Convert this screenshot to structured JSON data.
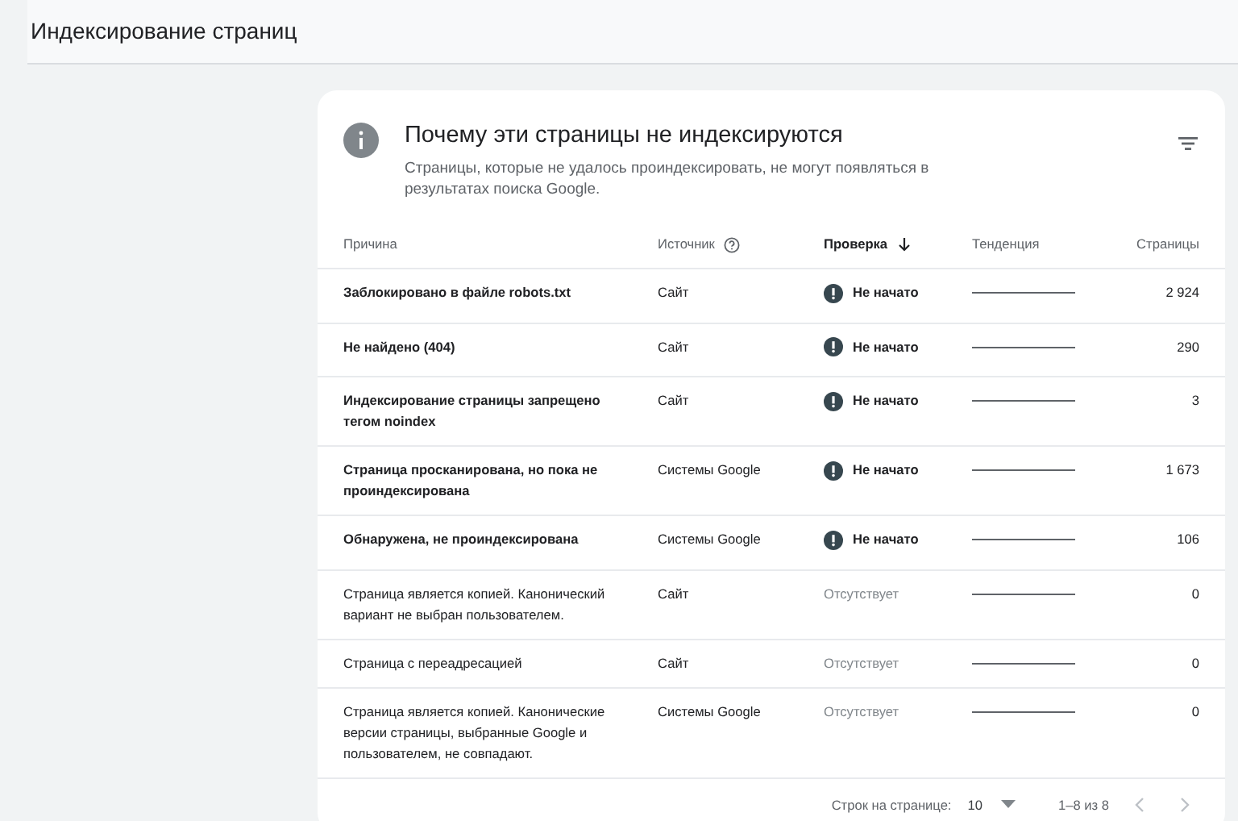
{
  "page_title": "Индексирование страниц",
  "card": {
    "title": "Почему эти страницы не индексируются",
    "subtitle": "Страницы, которые не удалось проиндексировать, не могут появляться в результатах поиска Google."
  },
  "table": {
    "columns": [
      {
        "label": "Причина",
        "sorted": false,
        "help": false
      },
      {
        "label": "Источник",
        "sorted": false,
        "help": true
      },
      {
        "label": "Проверка",
        "sorted": true,
        "help": false
      },
      {
        "label": "Тенденция",
        "sorted": false,
        "help": false
      },
      {
        "label": "Страницы",
        "sorted": false,
        "help": false
      }
    ],
    "rows": [
      {
        "reason": "Заблокировано в файле robots.txt",
        "source": "Сайт",
        "validation": {
          "text": "Не начато",
          "kind": "warning"
        },
        "pages": "2 924"
      },
      {
        "reason": "Не найдено (404)",
        "source": "Сайт",
        "validation": {
          "text": "Не начато",
          "kind": "warning"
        },
        "pages": "290"
      },
      {
        "reason": "Индексирование страницы запрещено тегом noindex",
        "source": "Сайт",
        "validation": {
          "text": "Не начато",
          "kind": "warning"
        },
        "pages": "3"
      },
      {
        "reason": "Страница просканирована, но пока не проиндексирована",
        "source": "Системы Google",
        "validation": {
          "text": "Не начато",
          "kind": "warning"
        },
        "pages": "1 673"
      },
      {
        "reason": "Обнаружена, не проиндексирована",
        "source": "Системы Google",
        "validation": {
          "text": "Не начато",
          "kind": "warning"
        },
        "pages": "106"
      },
      {
        "reason": "Страница является копией. Канонический вариант не выбран пользователем.",
        "source": "Сайт",
        "validation": {
          "text": "Отсутствует",
          "kind": "none"
        },
        "pages": "0"
      },
      {
        "reason": "Страница с переадресацией",
        "source": "Сайт",
        "validation": {
          "text": "Отсутствует",
          "kind": "none"
        },
        "pages": "0"
      },
      {
        "reason": "Страница является копией. Канонические версии страницы, выбранные Google и пользователем, не совпадают.",
        "source": "Системы Google",
        "validation": {
          "text": "Отсутствует",
          "kind": "none"
        },
        "pages": "0"
      }
    ]
  },
  "pagination": {
    "rows_label": "Строк на странице:",
    "rows_value": "10",
    "range": "1–8 из 8",
    "prev_disabled": true,
    "next_disabled": true
  }
}
